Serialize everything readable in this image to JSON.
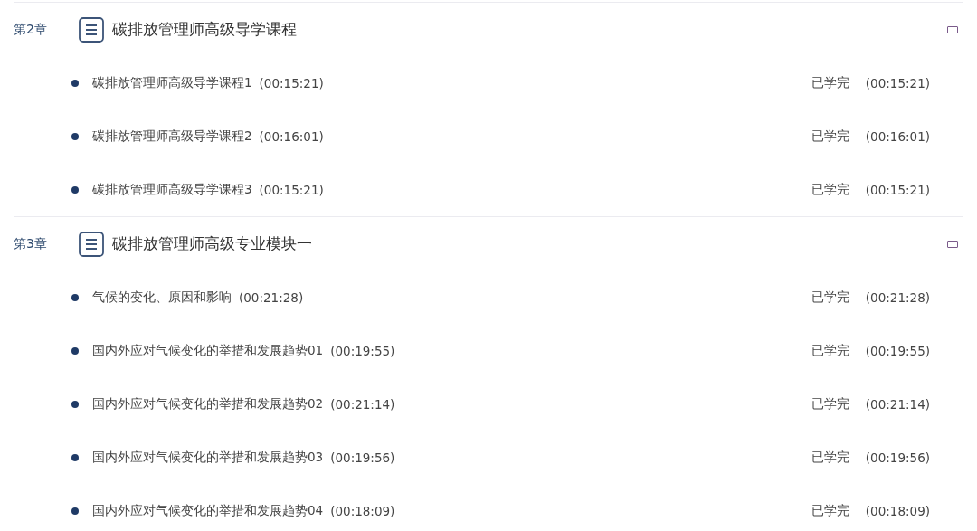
{
  "chapters": [
    {
      "label": "第2章",
      "title": "碳排放管理师高级导学课程",
      "lessons": [
        {
          "title": "碳排放管理师高级导学课程1",
          "duration": "(00:15:21)",
          "status": "已学完",
          "time": "(00:15:21)"
        },
        {
          "title": "碳排放管理师高级导学课程2",
          "duration": "(00:16:01)",
          "status": "已学完",
          "time": "(00:16:01)"
        },
        {
          "title": "碳排放管理师高级导学课程3",
          "duration": "(00:15:21)",
          "status": "已学完",
          "time": "(00:15:21)"
        }
      ]
    },
    {
      "label": "第3章",
      "title": "碳排放管理师高级专业模块一",
      "lessons": [
        {
          "title": "气候的变化、原因和影响",
          "duration": "(00:21:28)",
          "status": "已学完",
          "time": "(00:21:28)"
        },
        {
          "title": "国内外应对气候变化的举措和发展趋势01",
          "duration": "(00:19:55)",
          "status": "已学完",
          "time": "(00:19:55)"
        },
        {
          "title": "国内外应对气候变化的举措和发展趋势02",
          "duration": "(00:21:14)",
          "status": "已学完",
          "time": "(00:21:14)"
        },
        {
          "title": "国内外应对气候变化的举措和发展趋势03",
          "duration": "(00:19:56)",
          "status": "已学完",
          "time": "(00:19:56)"
        },
        {
          "title": "国内外应对气候变化的举措和发展趋势04",
          "duration": "(00:18:09)",
          "status": "已学完",
          "time": "(00:18:09)"
        }
      ]
    }
  ]
}
